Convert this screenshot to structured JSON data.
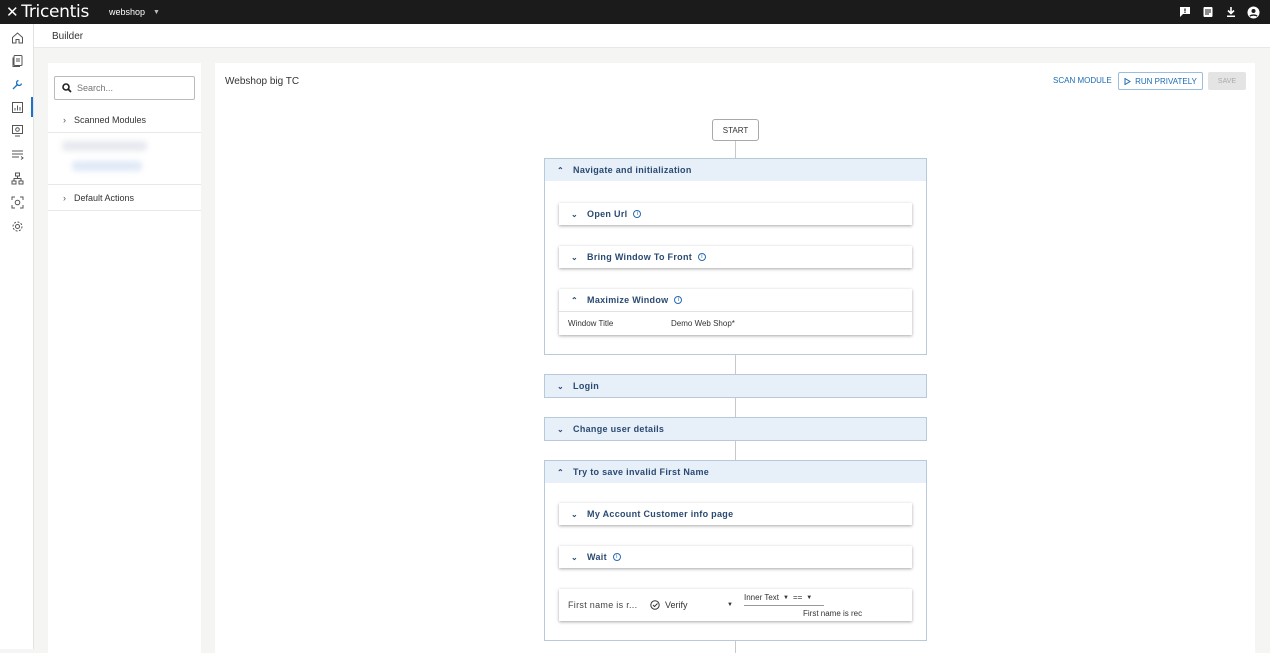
{
  "topbar": {
    "brand": "Tricentis",
    "project": "webshop"
  },
  "breadcrumb": {
    "title": "Builder"
  },
  "sidebar": {
    "search_placeholder": "Search...",
    "items": [
      {
        "label": "Scanned Modules"
      },
      {
        "label": "Default Actions"
      }
    ]
  },
  "main": {
    "title": "Webshop big TC",
    "scan_module": "SCAN MODULE",
    "run_privately": "RUN PRIVATELY",
    "save": "SAVE",
    "start": "START",
    "blocks": [
      {
        "label": "Navigate and initialization",
        "steps": [
          {
            "label": "Open Url"
          },
          {
            "label": "Bring Window To Front"
          },
          {
            "label": "Maximize Window",
            "param_name": "Window Title",
            "param_value": "Demo Web Shop*"
          }
        ]
      },
      {
        "label": "Login"
      },
      {
        "label": "Change user details"
      },
      {
        "label": "Try to save invalid First Name",
        "steps": [
          {
            "label": "My Account Customer info page"
          },
          {
            "label": "Wait"
          },
          {
            "name": "First name is r...",
            "action": "Verify",
            "property": "Inner Text",
            "operator": "==",
            "value": "First name is rec"
          }
        ]
      }
    ]
  },
  "colors": {
    "accent": "#1a6bb5",
    "topbar": "#1b1b1b",
    "block_header": "#e7eff9"
  }
}
